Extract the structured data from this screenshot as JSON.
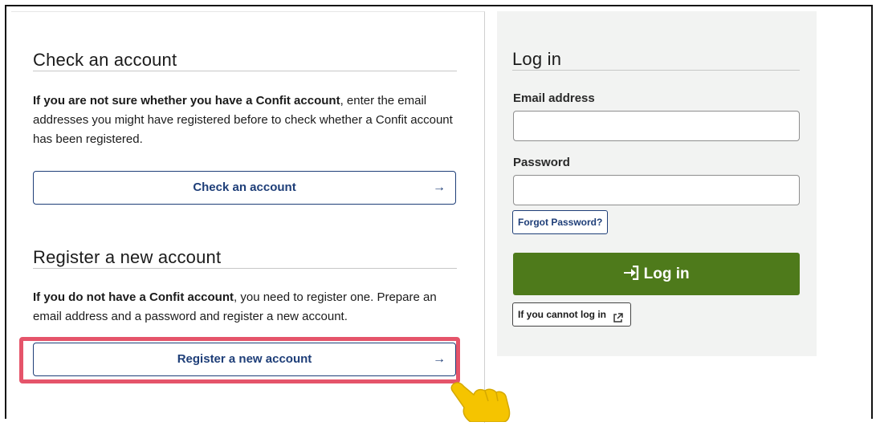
{
  "check_section": {
    "heading": "Check an account",
    "intro_bold": "If you are not sure whether you have a Confit account",
    "intro_rest": ", enter the email addresses you might have registered before to check whether a Confit account has been registered.",
    "button_label": "Check an account"
  },
  "register_section": {
    "heading": "Register a new account",
    "intro_bold": "If you do not have a Confit account",
    "intro_rest": ", you need to register one. Prepare an email address and a password and register a new account.",
    "button_label": "Register a new account"
  },
  "login": {
    "heading": "Log in",
    "email_label": "Email address",
    "email_value": "",
    "password_label": "Password",
    "password_value": "",
    "forgot_label": "Forgot Password?",
    "submit_label": "Log in",
    "cannot_login_label": "If you cannot log in"
  },
  "icons": {
    "arrow": "arrow-right-icon",
    "login": "sign-in-icon",
    "external": "external-link-icon",
    "pointer": "pointing-hand-icon"
  },
  "colors": {
    "primary_text": "#1e3e78",
    "login_green": "#4e7a1b",
    "highlight": "#e5546a",
    "pointer": "#f5c400",
    "panel_bg": "#f2f3f2"
  }
}
